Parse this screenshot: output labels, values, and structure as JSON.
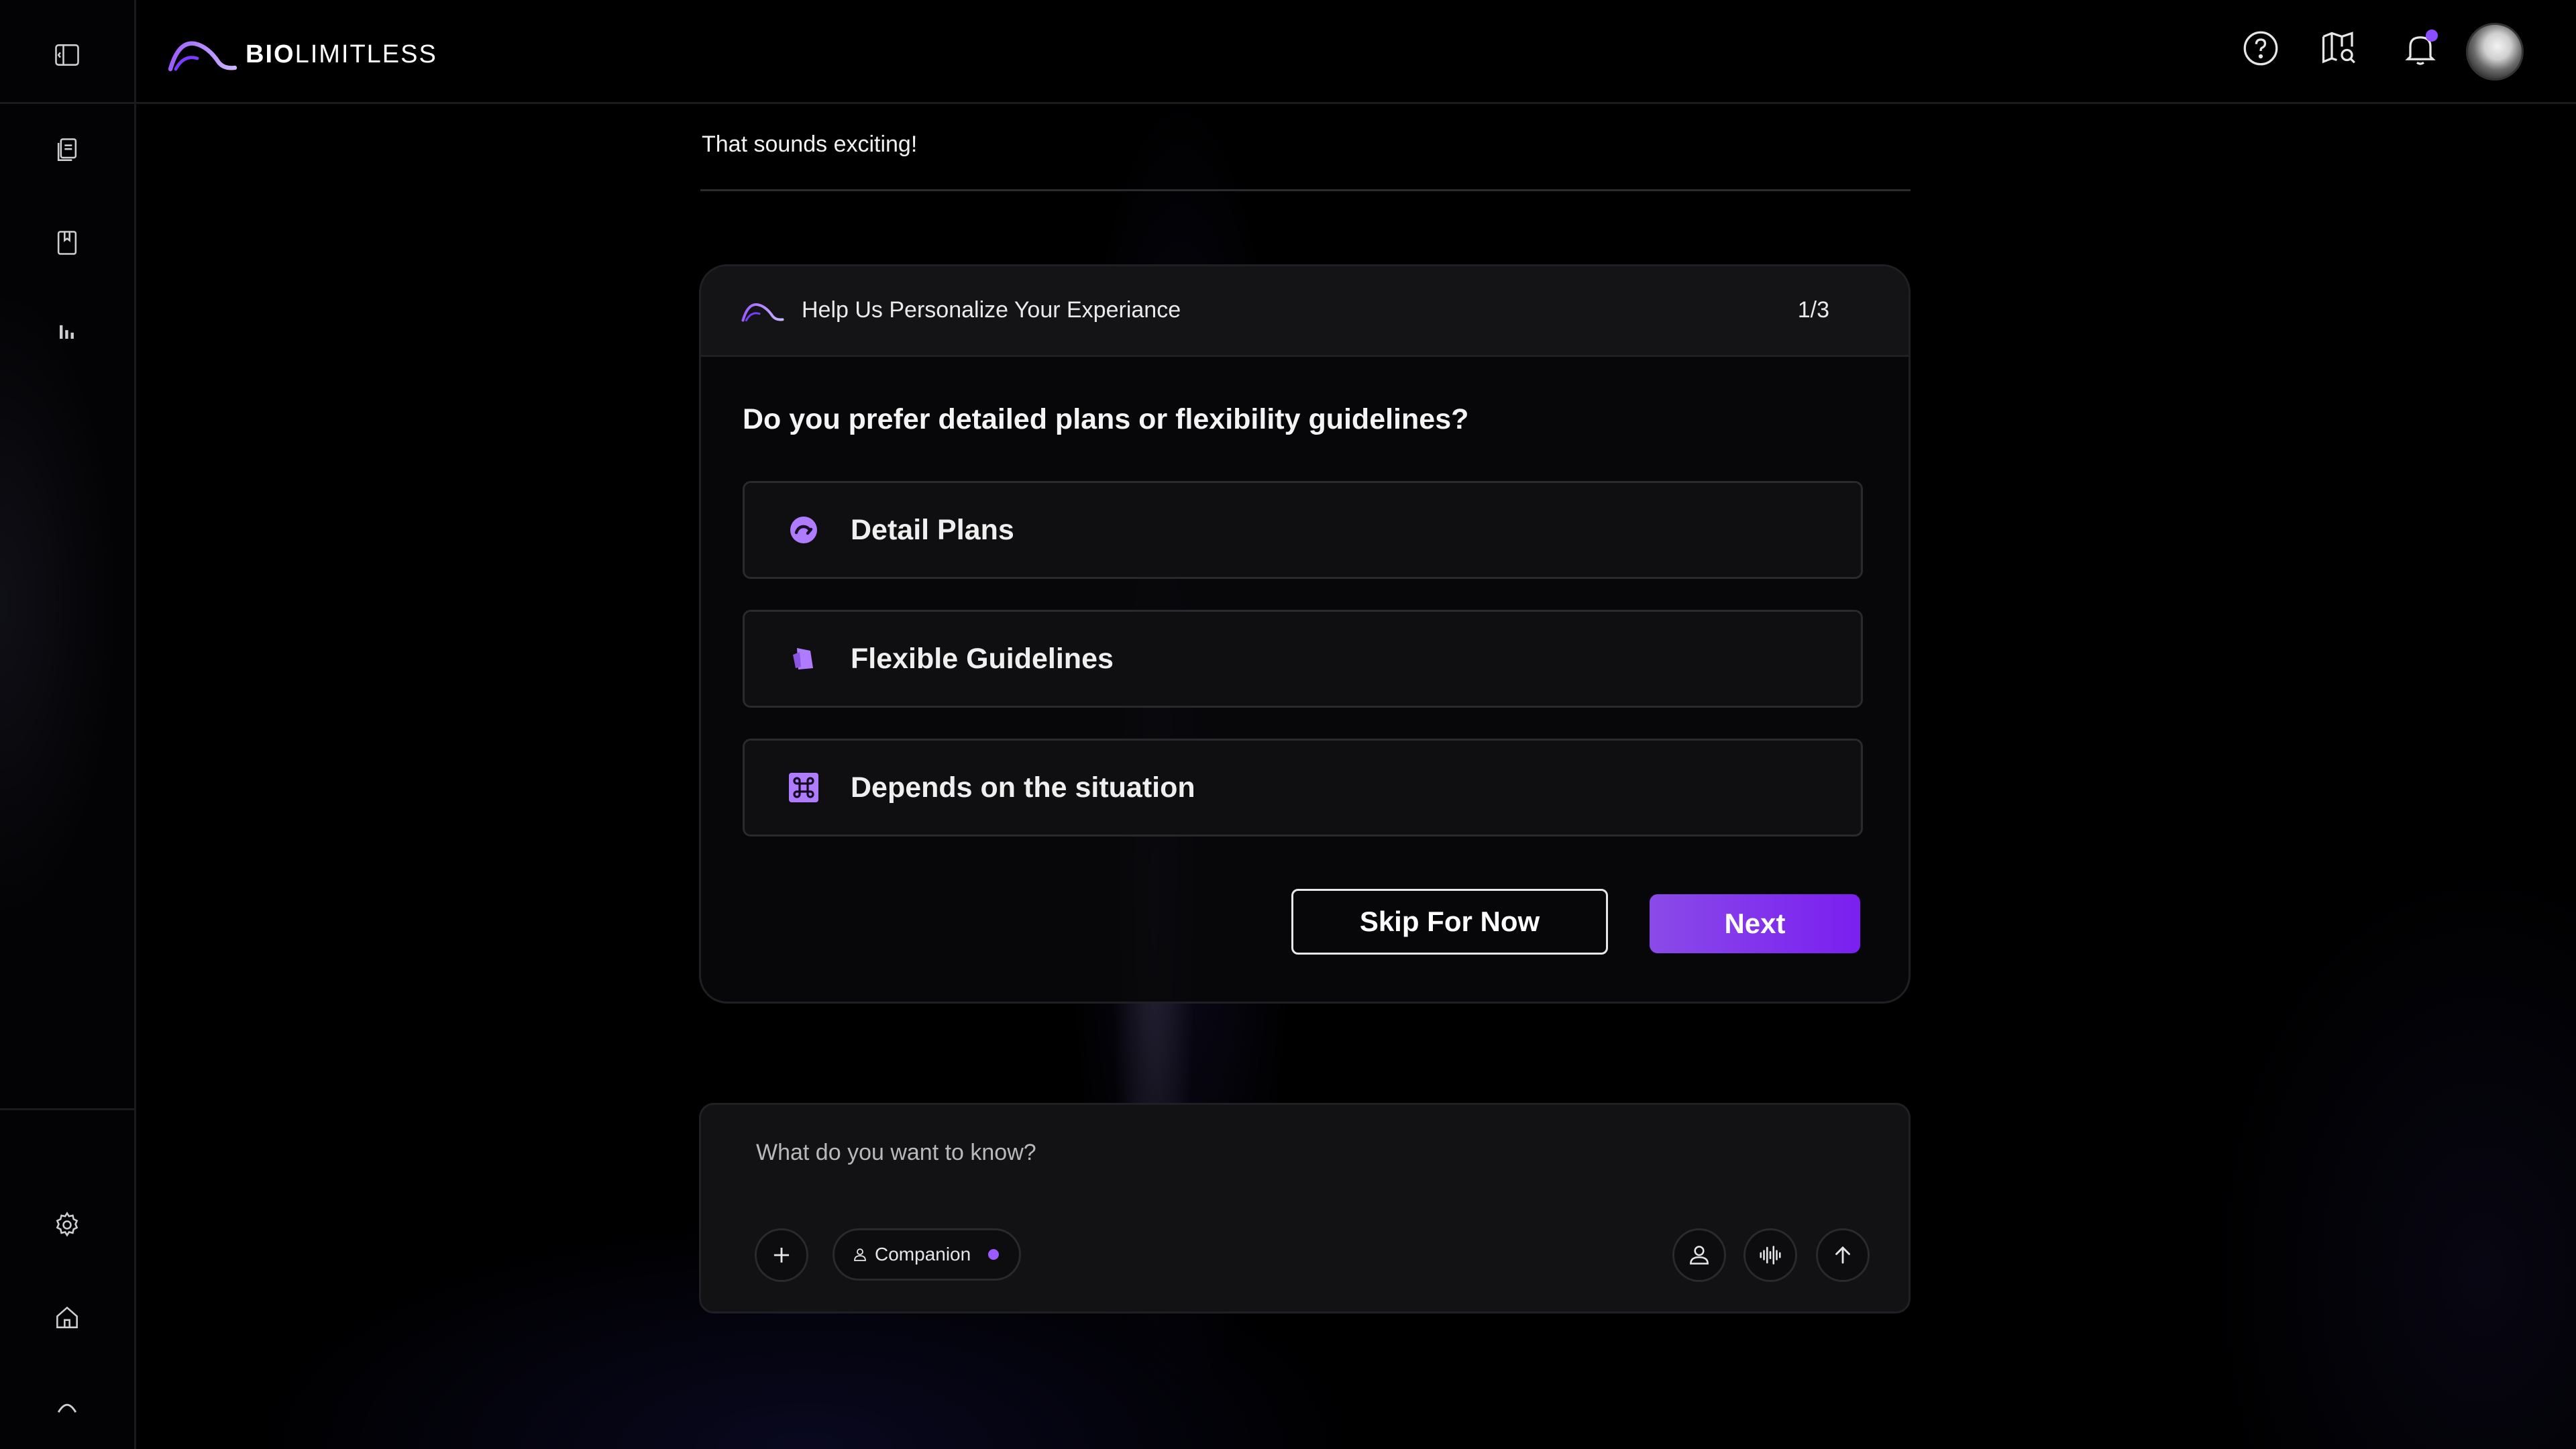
{
  "colors": {
    "accent": "#8a4dff",
    "button_gradient_start": "#8a4ae8",
    "button_gradient_end": "#7a1ff0",
    "background": "#000000"
  },
  "sidebar": {
    "top_icons": [
      "sidebar-toggle-icon",
      "notes-icon",
      "bookmark-icon",
      "bar-chart-icon"
    ],
    "bottom_icons": [
      "gear-icon",
      "home-icon",
      "arc-logo-icon"
    ]
  },
  "header": {
    "logo_bold": "BIO",
    "logo_light": "LIMITLESS",
    "icons": [
      "help-icon",
      "map-search-icon",
      "bell-icon",
      "avatar"
    ]
  },
  "conversation": {
    "previous_message": "That sounds exciting!"
  },
  "survey": {
    "title": "Help Us Personalize Your Experiance",
    "step": "1/3",
    "question": "Do you prefer detailed plans or flexibility guidelines?",
    "options": [
      {
        "label": "Detail Plans",
        "icon": "gauge-icon"
      },
      {
        "label": "Flexible Guidelines",
        "icon": "tag-icon"
      },
      {
        "label": "Depends on the situation",
        "icon": "command-icon"
      }
    ],
    "skip_label": "Skip For Now",
    "next_label": "Next"
  },
  "composer": {
    "placeholder": "What do you want to know?",
    "mode_chip": "Companion"
  }
}
